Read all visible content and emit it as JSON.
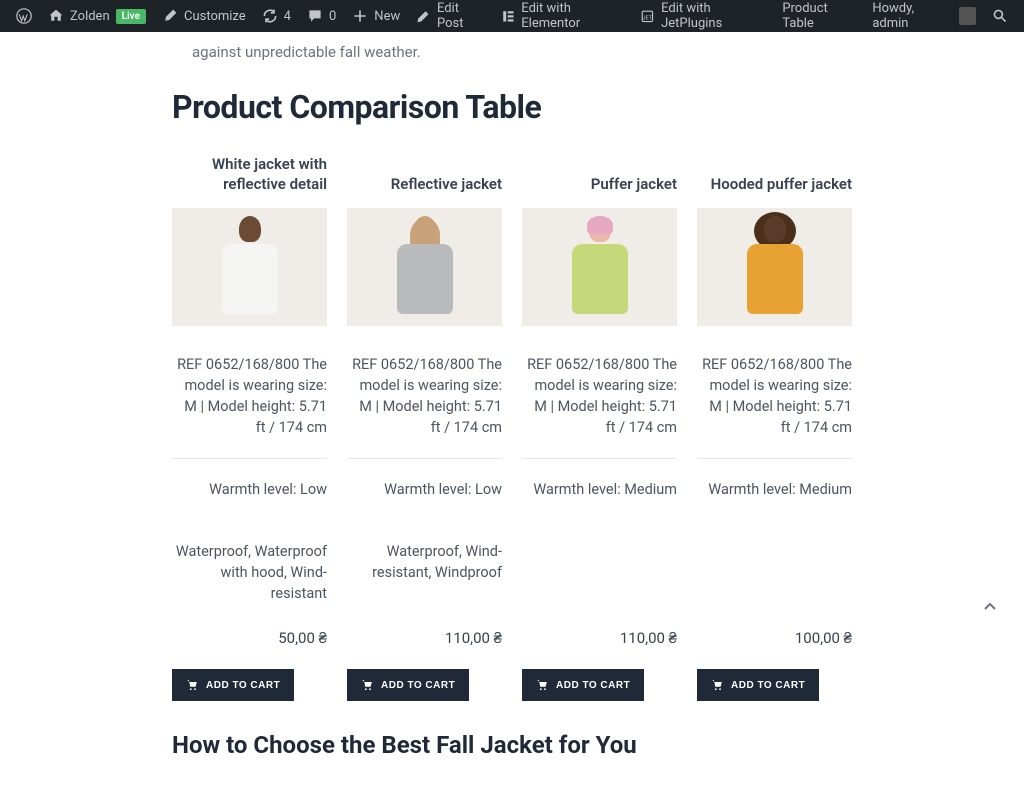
{
  "adminBar": {
    "siteName": "Zolden",
    "liveLabel": "Live",
    "customize": "Customize",
    "updates": "4",
    "comments": "0",
    "newItem": "New",
    "editPost": "Edit Post",
    "editElementor": "Edit with Elementor",
    "editJetPlugins": "Edit with JetPlugins",
    "productTable": "Product Table",
    "howdy": "Howdy, admin"
  },
  "page": {
    "introText": "against unpredictable fall weather.",
    "comparisonTitle": "Product Comparison Table",
    "howToTitle": "How to Choose the Best Fall Jacket for You"
  },
  "products": [
    {
      "name": "White jacket with reflective detail",
      "ref": "REF 0652/168/800 The model is wearing size: M | Model height: 5.71 ft / 174 cm",
      "warmth": "Warmth level: Low",
      "features": "Waterproof, Waterproof with hood, Wind-resistant",
      "price": "50,00 ₴",
      "btn": "ADD TO CART"
    },
    {
      "name": "Reflective jacket",
      "ref": "REF 0652/168/800 The model is wearing size: M | Model height: 5.71 ft / 174 cm",
      "warmth": "Warmth level: Low",
      "features": "Waterproof, Wind-resistant, Windproof",
      "price": "110,00 ₴",
      "btn": "ADD TO CART"
    },
    {
      "name": "Puffer jacket",
      "ref": "REF 0652/168/800 The model is wearing size: M | Model height: 5.71 ft / 174 cm",
      "warmth": "Warmth level: Medium",
      "features": "",
      "price": "110,00 ₴",
      "btn": "ADD TO CART"
    },
    {
      "name": "Hooded puffer jacket",
      "ref": "REF 0652/168/800 The model is wearing size: M | Model height: 5.71 ft / 174 cm",
      "warmth": "Warmth level: Medium",
      "features": "",
      "price": "100,00 ₴",
      "btn": "ADD TO CART"
    }
  ]
}
